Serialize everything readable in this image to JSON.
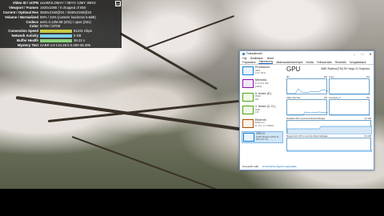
{
  "stats": {
    "rows": [
      {
        "label": "Video ID / sCPN",
        "value": "oxU92VLO8mY / 0BYO 13MY 3MX2"
      },
      {
        "label": "Viewport / Frames",
        "value": "1920x1080 / 0 dropped of 850"
      },
      {
        "label": "Current / Optimal Res",
        "value": "3840x2160@24 / 3840x2160@24"
      },
      {
        "label": "Volume / Normalized",
        "value": "69% / 34% (content loudness 5.6dB)"
      },
      {
        "label": "Codecs",
        "value": "av01.0.12M.08 (401) / opus (251)"
      },
      {
        "label": "Color",
        "value": "bt709 / bt709"
      },
      {
        "label": "Connection Speed",
        "value": "81231 Kbps",
        "bar_color": "#c9c943"
      },
      {
        "label": "Network Activity",
        "value": "0 KB",
        "bar_color": "#7dd0e8"
      },
      {
        "label": "Buffer Health",
        "value": "38.22 s",
        "bar_color": "#8ad07d"
      },
      {
        "label": "Mystery Text",
        "value": "SABR s:8 t:34.38 b:0.000-38.395"
      }
    ],
    "close_label": "[x]"
  },
  "taskmanager": {
    "title": "Feladatkezelő",
    "window_buttons": [
      "–",
      "□",
      "✕"
    ],
    "menu": [
      "Fájl",
      "Beállítások",
      "Nézet"
    ],
    "tabs": [
      "Folyamatok",
      "Teljesítmény",
      "Alkalmazáselőzmények",
      "Indítás",
      "Felhasználók",
      "Részletek",
      "Szolgáltatások"
    ],
    "active_tab": 1,
    "side": [
      {
        "name": "Processzor",
        "sub1": "49%",
        "sub2": "3,27 GHz",
        "color": "#1182d4"
      },
      {
        "name": "Memória",
        "sub1": "6,7/13,9 GB",
        "sub2": "(48%)",
        "color": "#8b12ae"
      },
      {
        "name": "0. lemez (E:)",
        "sub1": "HDD",
        "sub2": "0%",
        "color": "#4da60c"
      },
      {
        "name": "1. lemez (C: D:)",
        "sub1": "SSD",
        "sub2": "1%",
        "color": "#4da60c"
      },
      {
        "name": "Ethernet",
        "sub1": "Ethernet",
        "sub2": "K: 0 F: 2,7 Mbit/s",
        "color": "#a74f01"
      },
      {
        "name": "GPU 0",
        "sub1": "AMD Radeon(TM) R...",
        "sub2": "8% (76 °C)",
        "color": "#1182d4"
      }
    ],
    "gpu_title": "GPU",
    "gpu_name": "AMD Radeon(TM) RX Vega 11 Graphics",
    "graphs": {
      "g3d": {
        "label": "3D",
        "value": "8%"
      },
      "copy": {
        "label": "Copy",
        "value": "0%"
      },
      "decode": {
        "label": "Video Decode",
        "value": "9%"
      },
      "compute": {
        "label": "Compute_0",
        "value": "0%"
      },
      "dedicated": {
        "label": "Dedikált GPU-memória kihasználtsága",
        "value": "2,0 GB"
      },
      "shared": {
        "label": "Megosztott GPU-memória kihasználtsága",
        "value": "6,9 GB"
      }
    },
    "footer": {
      "fewer": "Kevesebb adat",
      "monitor": "Az Erőforrás-figyelő megnyitása"
    }
  }
}
